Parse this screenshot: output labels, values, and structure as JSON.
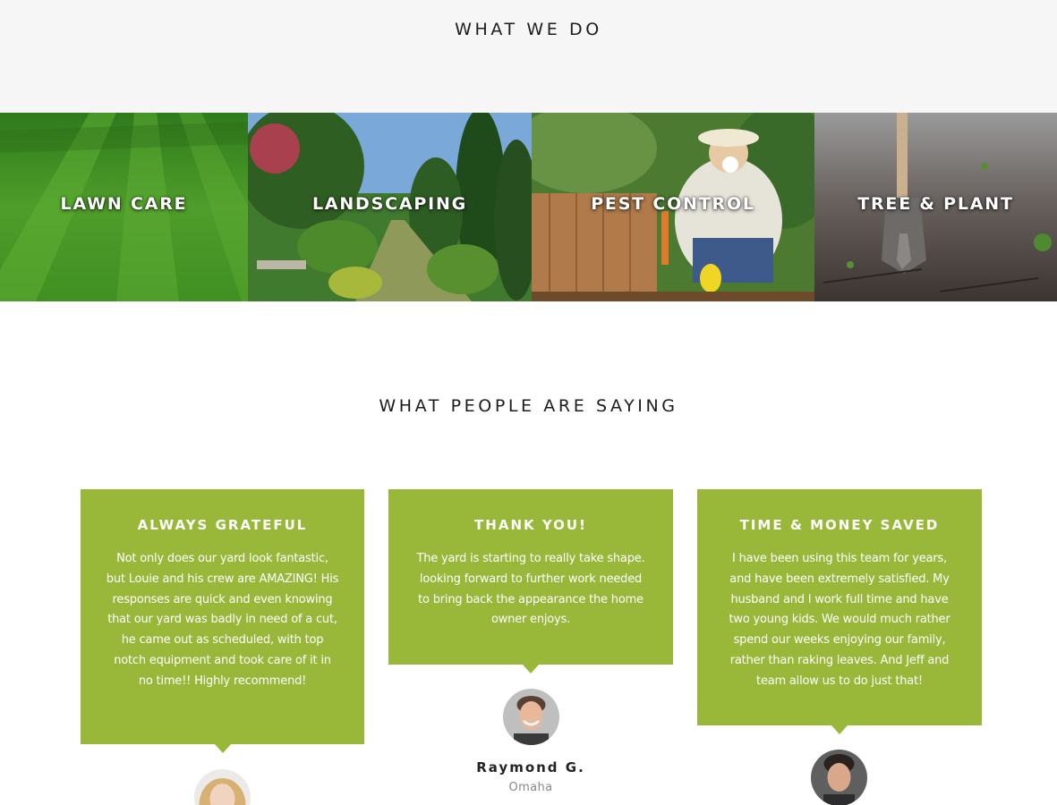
{
  "what_we_do": {
    "title": "WHAT WE DO",
    "services": [
      {
        "label": "LAWN CARE"
      },
      {
        "label": "LANDSCAPING"
      },
      {
        "label": "PEST CONTROL"
      },
      {
        "label": "TREE & PLANT"
      }
    ]
  },
  "testimonials": {
    "title": "WHAT PEOPLE ARE SAYING",
    "items": [
      {
        "title": "ALWAYS GRATEFUL",
        "body": "Not only does our yard look fantastic, but Louie and his crew are AMAZING! His responses are quick and even knowing that our yard was badly in need of a cut, he came out as scheduled, with top notch equipment and took care of it in no time!! Highly recommend!"
      },
      {
        "title": "THANK YOU!",
        "body": "The yard is starting to really take shape. looking forward to further work needed to bring back the appearance the home owner enjoys.",
        "name": "Raymond G.",
        "city": "Omaha"
      },
      {
        "title": "TIME & MONEY SAVED",
        "body": "I have been using this team for years, and have been extremely satisfied. My husband and I work full time and have two young kids. We would much rather spend our weeks enjoying our family, rather than raking leaves. And Jeff and team allow us to do just that!"
      }
    ]
  },
  "colors": {
    "accent_green": "#99b83a",
    "band_gray": "#f6f6f6"
  }
}
